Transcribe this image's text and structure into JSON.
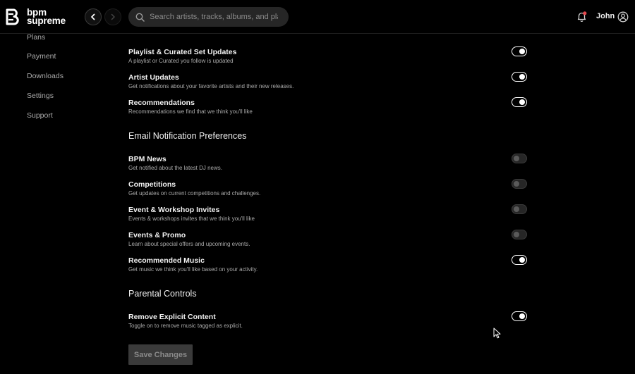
{
  "brand": {
    "line1": "bpm",
    "line2": "supreme"
  },
  "search": {
    "placeholder": "Search artists, tracks, albums, and playlists"
  },
  "user": {
    "name": "John"
  },
  "sidebar": {
    "items": [
      {
        "label": "Plans"
      },
      {
        "label": "Payment"
      },
      {
        "label": "Downloads"
      },
      {
        "label": "Settings"
      },
      {
        "label": "Support"
      }
    ]
  },
  "push_settings": [
    {
      "title": "Playlist & Curated Set Updates",
      "desc": "A playlist or Curated you follow is updated",
      "enabled": true
    },
    {
      "title": "Artist Updates",
      "desc": "Get notifications about your favorite artists and their new releases.",
      "enabled": true
    },
    {
      "title": "Recommendations",
      "desc": "Recommendations we find that we think you'll like",
      "enabled": true
    }
  ],
  "email_section": {
    "title": "Email Notification Preferences",
    "items": [
      {
        "title": "BPM News",
        "desc": "Get notified about the latest DJ news.",
        "enabled": false
      },
      {
        "title": "Competitions",
        "desc": "Get updates on current competitions and challenges.",
        "enabled": false
      },
      {
        "title": "Event & Workshop Invites",
        "desc": "Events & workshops invites that we think you'll like",
        "enabled": false
      },
      {
        "title": "Events & Promo",
        "desc": "Learn about special offers and upcoming events.",
        "enabled": false
      },
      {
        "title": "Recommended Music",
        "desc": "Get music we think you'll like based on your activity.",
        "enabled": true
      }
    ]
  },
  "parental_section": {
    "title": "Parental Controls",
    "items": [
      {
        "title": "Remove Explicit Content",
        "desc": "Toggle on to remove music tagged as explicit.",
        "enabled": true
      }
    ]
  },
  "save_button": {
    "label": "Save Changes"
  },
  "icons": {
    "logo": "bpm-logo-icon",
    "back": "chevron-left-icon",
    "forward": "chevron-right-icon",
    "search": "search-icon",
    "bell": "bell-icon",
    "user": "user-circle-icon",
    "cursor": "mouse-cursor-icon"
  },
  "colors": {
    "background": "#000000",
    "notification_dot": "#e5484d",
    "toggle_on": "#ffffff",
    "toggle_off": "#3a3a3a"
  }
}
